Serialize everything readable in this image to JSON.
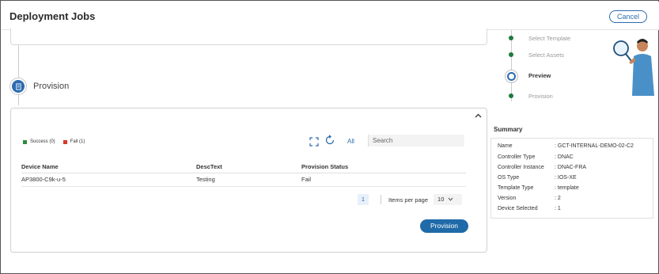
{
  "header": {
    "title": "Deployment Jobs",
    "cancel_label": "Cancel"
  },
  "section": {
    "title": "Provision"
  },
  "legend": {
    "success": "Success (0)",
    "fail": "Fail (1)",
    "success_color": "#2e8b3e",
    "fail_color": "#d9382b"
  },
  "toolbar": {
    "all_label": "All",
    "search_placeholder": "Search"
  },
  "table": {
    "headers": [
      "Device Name",
      "DescText",
      "Provision Status"
    ],
    "rows": [
      [
        "AP3800-C9k-u-5",
        "Testing",
        "Fail"
      ]
    ]
  },
  "pagination": {
    "page": "1",
    "items_per_page_label": "Items per page",
    "items_per_page": "10"
  },
  "provision_button": "Provision",
  "steps": [
    {
      "label": "Select Template"
    },
    {
      "label": "Select Assets"
    },
    {
      "label": "Preview",
      "active": true
    },
    {
      "label": "Provision"
    }
  ],
  "summary": {
    "title": "Summary",
    "rows": [
      {
        "key": "Name",
        "value": ": GCT-INTERNAL-DEMO-02-C2"
      },
      {
        "key": "Controller Type",
        "value": ": DNAC"
      },
      {
        "key": "Controller Instance",
        "value": ": DNAC-FRA"
      },
      {
        "key": "OS Type",
        "value": ": IOS-XE"
      },
      {
        "key": "Template Type",
        "value": ": template"
      },
      {
        "key": "Version",
        "value": ": 2"
      },
      {
        "key": "Device Selected",
        "value": ": 1"
      }
    ]
  }
}
